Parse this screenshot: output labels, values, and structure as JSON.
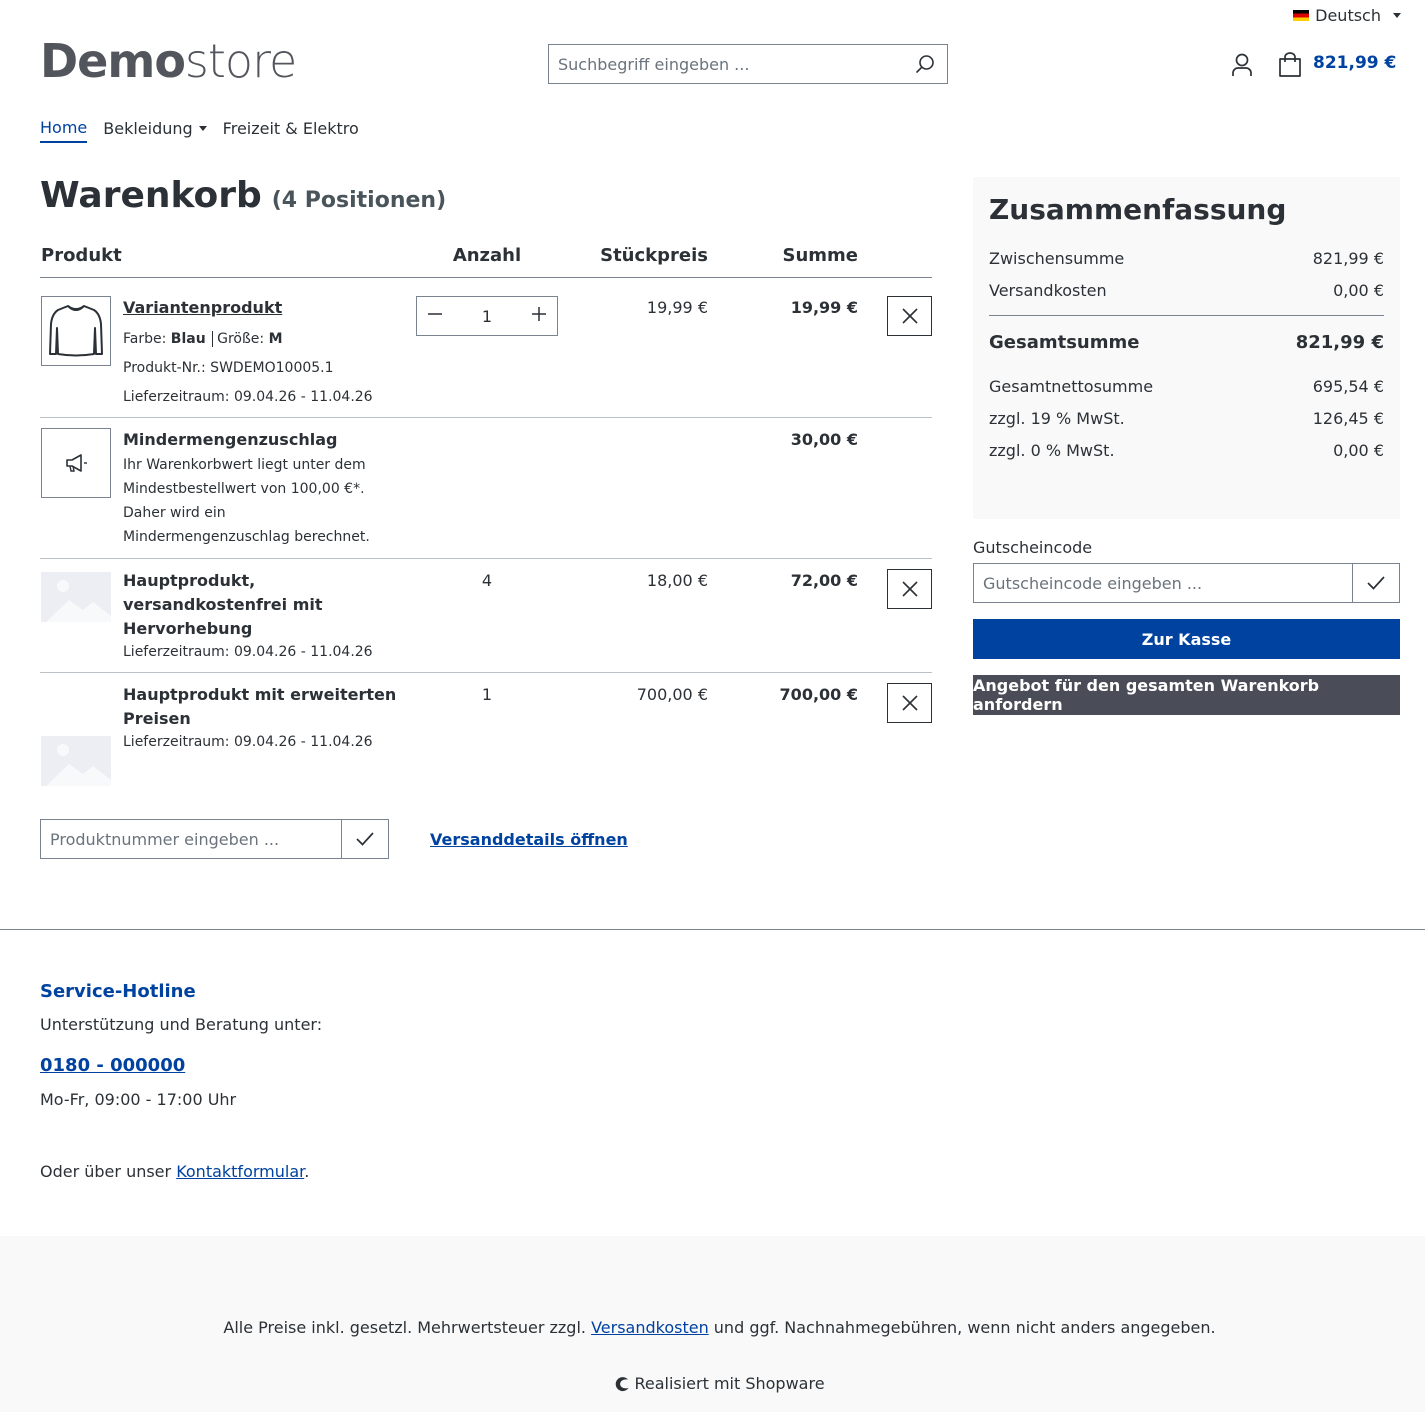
{
  "header": {
    "language": "Deutsch",
    "logo_bold": "Demo",
    "logo_light": "store",
    "search_placeholder": "Suchbegriff eingeben ...",
    "cart_total": "821,99 €"
  },
  "nav": {
    "items": [
      {
        "label": "Home"
      },
      {
        "label": "Bekleidung"
      },
      {
        "label": "Freizeit & Elektro"
      }
    ]
  },
  "cart": {
    "title": "Warenkorb",
    "count": "(4 Positionen)",
    "columns": {
      "product": "Produkt",
      "quantity": "Anzahl",
      "unit_price": "Stückpreis",
      "total": "Summe"
    },
    "items": [
      {
        "name": "Variantenprodukt",
        "color_label": "Farbe:",
        "color_value": "Blau",
        "size_label": "Größe:",
        "size_value": "M",
        "number": "Produkt-Nr.: SWDEMO10005.1",
        "delivery": "Lieferzeitraum: 09.04.26 - 11.04.26",
        "quantity": "1",
        "unit_price": "19,99 €",
        "total": "19,99 €"
      },
      {
        "name": "Mindermengenzuschlag",
        "desc1": "Ihr Warenkorbwert liegt unter dem",
        "desc2": "Mindestbestellwert von 100,00 €*.",
        "desc3": "Daher wird ein",
        "desc4": "Mindermengenzuschlag berechnet.",
        "total": "30,00 €"
      },
      {
        "name1": "Hauptprodukt,",
        "name2": "versandkostenfrei mit",
        "name3": "Hervorhebung",
        "delivery": "Lieferzeitraum: 09.04.26 - 11.04.26",
        "quantity": "4",
        "unit_price": "18,00 €",
        "total": "72,00 €"
      },
      {
        "name1": "Hauptprodukt mit erweiterten",
        "name2": "Preisen",
        "delivery": "Lieferzeitraum: 09.04.26 - 11.04.26",
        "quantity": "1",
        "unit_price": "700,00 €",
        "total": "700,00 €"
      }
    ],
    "product_number_placeholder": "Produktnummer eingeben ...",
    "shipping_link": "Versanddetails öffnen"
  },
  "summary": {
    "title": "Zusammenfassung",
    "subtotal_label": "Zwischensumme",
    "subtotal": "821,99 €",
    "shipping_label": "Versandkosten",
    "shipping": "0,00 €",
    "grand_label": "Gesamtsumme",
    "grand": "821,99 €",
    "net_label": "Gesamtnettosumme",
    "net": "695,54 €",
    "vat19_label": "zzgl. 19 % MwSt.",
    "vat19": "126,45 €",
    "vat0_label": "zzgl. 0 % MwSt.",
    "vat0": "0,00 €",
    "voucher_label": "Gutscheincode",
    "voucher_placeholder": "Gutscheincode eingeben ...",
    "checkout": "Zur Kasse",
    "quote": "Angebot für den gesamten Warenkorb anfordern"
  },
  "footer": {
    "hotline_title": "Service-Hotline",
    "hotline_text": "Unterstützung und Beratung unter:",
    "phone": "0180 - 000000",
    "hours": "Mo-Fr, 09:00 - 17:00 Uhr",
    "contact_prefix": "Oder über unser ",
    "contact_link": "Kontaktformular",
    "contact_suffix": ".",
    "vat_prefix": "Alle Preise inkl. gesetzl. Mehrwertsteuer zzgl. ",
    "vat_link": "Versandkosten",
    "vat_suffix": " und ggf. Nachnahmegebühren, wenn nicht anders angegeben.",
    "powered": "Realisiert mit Shopware"
  },
  "colors": {
    "primary": "#0042a0",
    "dark_button": "#4a4d57",
    "text": "#2b3136"
  }
}
